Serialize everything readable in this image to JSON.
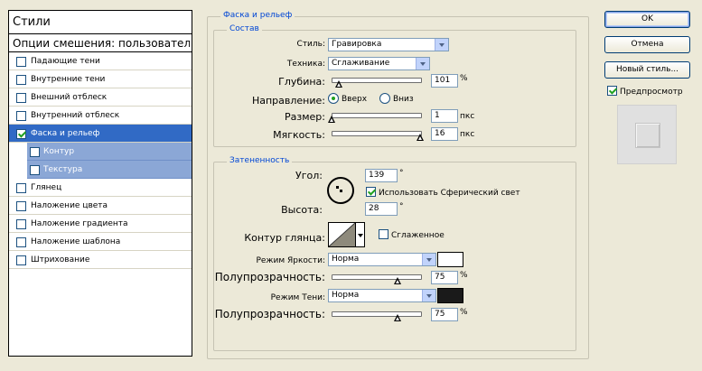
{
  "styles_panel": {
    "title": "Стили",
    "blending_options": "Опции смешения: пользовательск",
    "items": [
      {
        "label": "Падающие тени",
        "checked": false
      },
      {
        "label": "Внутренние тени",
        "checked": false
      },
      {
        "label": "Внешний отблеск",
        "checked": false
      },
      {
        "label": "Внутренний отблеск",
        "checked": false
      },
      {
        "label": "Фаска и рельеф",
        "checked": true,
        "selected": true
      },
      {
        "label": "Контур",
        "checked": false,
        "sub": true
      },
      {
        "label": "Текстура",
        "checked": false,
        "sub": true
      },
      {
        "label": "Глянец",
        "checked": false
      },
      {
        "label": "Наложение цвета",
        "checked": false
      },
      {
        "label": "Наложение градиента",
        "checked": false
      },
      {
        "label": "Наложение шаблона",
        "checked": false
      },
      {
        "label": "Штрихование",
        "checked": false
      }
    ]
  },
  "bevel": {
    "group_title": "Фаска и рельеф",
    "structure": {
      "group_title": "Состав",
      "style_label": "Стиль:",
      "style_value": "Гравировка",
      "technique_label": "Техника:",
      "technique_value": "Сглаживание",
      "depth_label": "Глубина:",
      "depth_value": "101",
      "depth_unit": "%",
      "direction_label": "Направление:",
      "direction_up": "Вверх",
      "direction_down": "Вниз",
      "direction_selected": "up",
      "size_label": "Размер:",
      "size_value": "1",
      "size_unit": "пкс",
      "soften_label": "Мягкость:",
      "soften_value": "16",
      "soften_unit": "пкс"
    },
    "shading": {
      "group_title": "Затененность",
      "angle_label": "Угол:",
      "angle_value": "139",
      "angle_unit": "°",
      "global_light_label": "Использовать Сферический свет",
      "global_light_checked": true,
      "altitude_label": "Высота:",
      "altitude_value": "28",
      "altitude_unit": "°",
      "gloss_contour_label": "Контур глянца:",
      "anti_aliased_label": "Сглаженное",
      "anti_aliased_checked": false,
      "highlight_mode_label": "Режим Яркости:",
      "highlight_mode_value": "Норма",
      "highlight_color": "#ffffff",
      "highlight_opacity_label": "Полупрозрачность:",
      "highlight_opacity_value": "75",
      "highlight_opacity_unit": "%",
      "shadow_mode_label": "Режим Тени:",
      "shadow_mode_value": "Норма",
      "shadow_color": "#1a1a1a",
      "shadow_opacity_label": "Полупрозрачность:",
      "shadow_opacity_value": "75",
      "shadow_opacity_unit": "%"
    }
  },
  "buttons": {
    "ok": "OK",
    "cancel": "Отмена",
    "new_style": "Новый стиль...",
    "preview_label": "Предпросмотр",
    "preview_checked": true
  },
  "colors": {
    "selection": "#316ac5",
    "sub_selection": "#8ba7d6",
    "legend_text": "#0046d5"
  }
}
